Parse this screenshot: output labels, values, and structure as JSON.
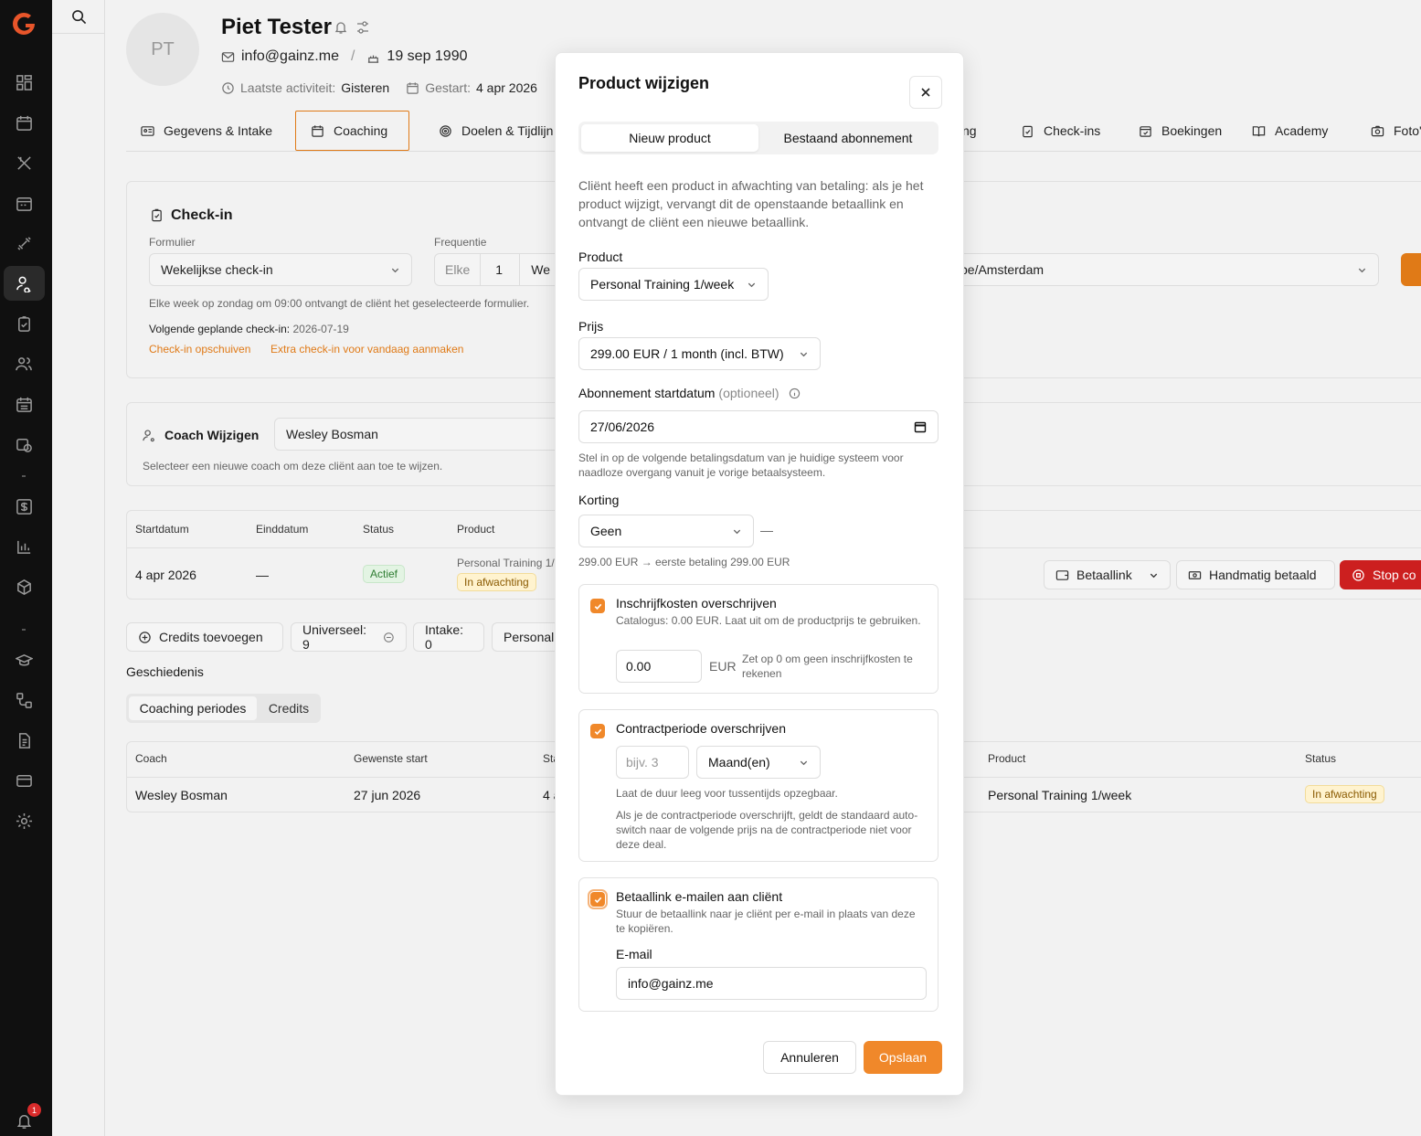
{
  "app": {
    "notification_count": "1"
  },
  "client": {
    "initials": "PT",
    "name": "Piet Tester",
    "email": "info@gainz.me",
    "separator": "/",
    "birthdate": "19 sep 1990",
    "last_activity_label": "Laatste activiteit:",
    "last_activity_value": "Gisteren",
    "started_label": "Gestart:",
    "started_value": "4 apr 2026"
  },
  "tabs": [
    {
      "label": "Gegevens & Intake",
      "icon": "id-card-icon"
    },
    {
      "label": "Coaching",
      "icon": "calendar-icon",
      "active": true
    },
    {
      "label": "Doelen & Tijdlijn",
      "icon": "target-icon"
    },
    {
      "label": "ng",
      "icon": ""
    },
    {
      "label": "Check-ins",
      "icon": "clipboard-check-icon"
    },
    {
      "label": "Boekingen",
      "icon": "calendar-check-icon"
    },
    {
      "label": "Academy",
      "icon": "book-icon"
    },
    {
      "label": "Foto's",
      "icon": "camera-icon"
    }
  ],
  "checkin": {
    "title": "Check-in",
    "form_label": "Formulier",
    "form_value": "Wekelijkse check-in",
    "freq_label": "Frequentie",
    "freq_every": "Elke",
    "freq_num": "1",
    "freq_unit": "We",
    "timezone": "pe/Amsterdam",
    "desc": "Elke week op zondag om 09:00 ontvangt de cliënt het geselecteerde formulier.",
    "next_label": "Volgende geplande check-in:",
    "next_value": "2026-07-19",
    "link_postpone": "Check-in opschuiven",
    "link_extra": "Extra check-in voor vandaag aanmaken"
  },
  "coach": {
    "label": "Coach Wijzigen",
    "value": "Wesley Bosman",
    "desc": "Selecteer een nieuwe coach om deze cliënt aan toe te wijzen."
  },
  "subscription_table": {
    "headers": [
      "Startdatum",
      "Einddatum",
      "Status",
      "Product"
    ],
    "row": {
      "start": "4 apr 2026",
      "end": "—",
      "status": "Actief",
      "product": "Personal Training 1/",
      "product_status": "In afwachting"
    },
    "actions": {
      "paylink": "Betaallink",
      "manual": "Handmatig betaald",
      "stop": "Stop co"
    }
  },
  "credits": {
    "add": "Credits toevoegen",
    "universal": "Universeel: 9",
    "intake": "Intake: 0",
    "personal": "Personal"
  },
  "history": {
    "title": "Geschiedenis",
    "tab_periods": "Coaching periodes",
    "tab_credits": "Credits",
    "headers": [
      "Coach",
      "Gewenste start",
      "Sta",
      "Product",
      "Status"
    ],
    "row": {
      "coach": "Wesley Bosman",
      "wanted_start": "27 jun 2026",
      "start": "4 a",
      "product": "Personal Training 1/week",
      "status": "In afwachting"
    }
  },
  "modal": {
    "title": "Product wijzigen",
    "tab_new": "Nieuw product",
    "tab_existing": "Bestaand abonnement",
    "info": "Cliënt heeft een product in afwachting van betaling: als je het product wijzigt, vervangt dit de openstaande betaallink en ontvangt de cliënt een nieuwe betaallink.",
    "product_label": "Product",
    "product_value": "Personal Training 1/week",
    "price_label": "Prijs",
    "price_value": "299.00 EUR / 1 month (incl. BTW)",
    "startdate_label": "Abonnement startdatum",
    "startdate_optional": "(optioneel)",
    "startdate_value": "27/06/2026",
    "startdate_help": "Stel in op de volgende betalingsdatum van je huidige systeem voor naadloze overgang vanuit je vorige betaalsysteem.",
    "discount_label": "Korting",
    "discount_value": "Geen",
    "discount_dash": "—",
    "discount_summary": "299.00 EUR → eerste betaling 299.00 EUR",
    "fee": {
      "title": "Inschrijfkosten overschrijven",
      "desc": "Catalogus: 0.00 EUR. Laat uit om de productprijs te gebruiken.",
      "value": "0.00",
      "unit": "EUR",
      "hint": "Zet op 0 om geen inschrijfkosten te rekenen"
    },
    "contract": {
      "title": "Contractperiode overschrijven",
      "placeholder": "bijv. 3",
      "unit_value": "Maand(en)",
      "help1": "Laat de duur leeg voor tussentijds opzegbaar.",
      "help2": "Als je de contractperiode overschrijft, geldt de standaard auto-switch naar de volgende prijs na de contractperiode niet voor deze deal."
    },
    "email": {
      "title": "Betaallink e-mailen aan cliënt",
      "desc": "Stuur de betaallink naar je cliënt per e-mail in plaats van deze te kopiëren.",
      "field_label": "E-mail",
      "value": "info@gainz.me"
    },
    "cancel": "Annuleren",
    "save": "Opslaan"
  },
  "colors": {
    "accent": "#f0882a",
    "sidebar": "#101010",
    "danger": "#cc1f1f"
  }
}
